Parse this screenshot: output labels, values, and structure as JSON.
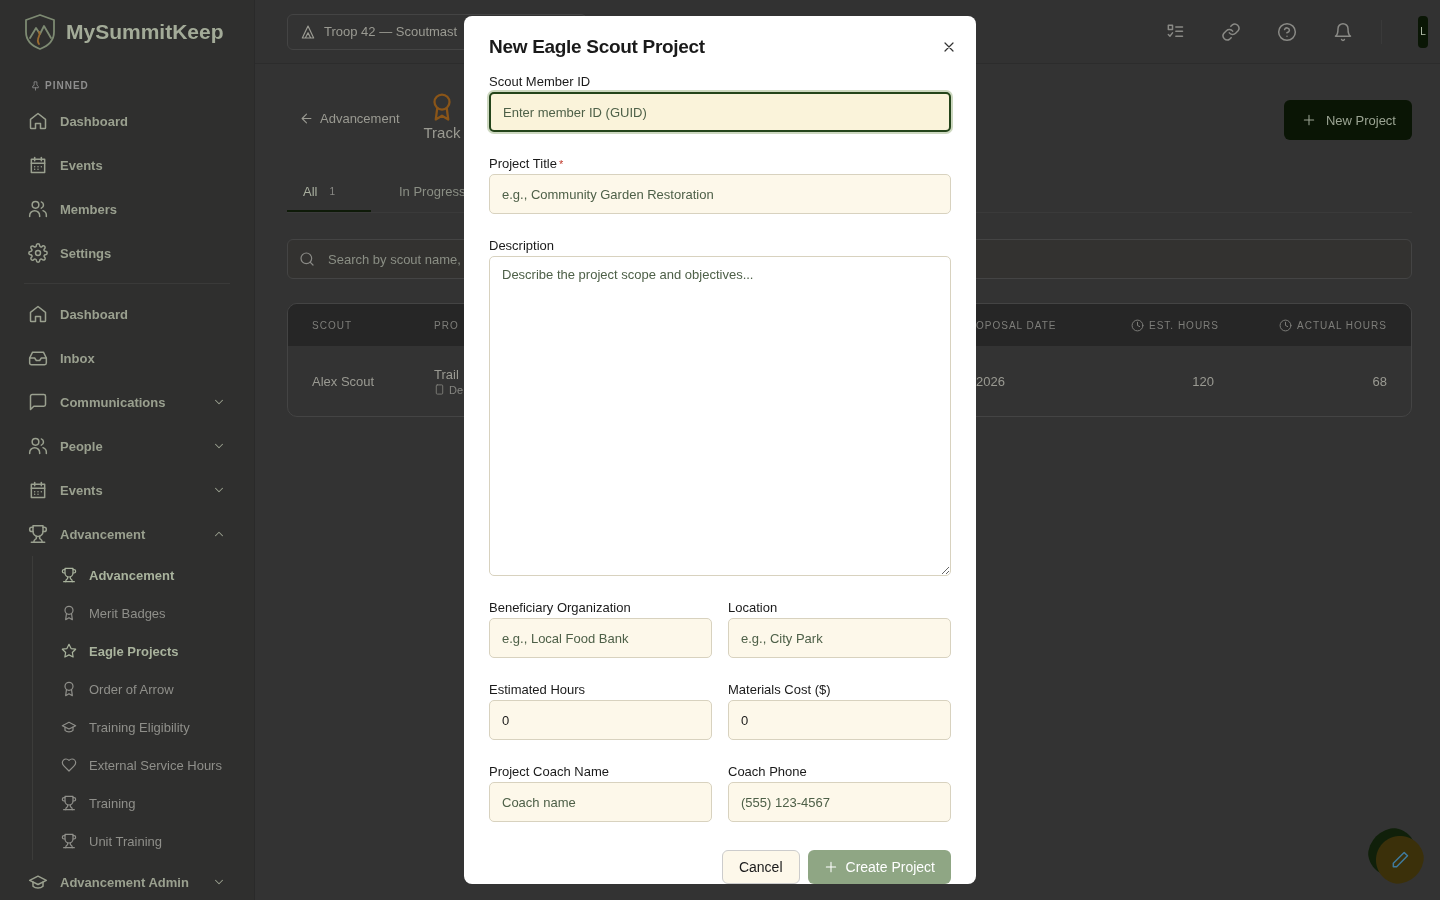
{
  "app": {
    "logo_text": "MySummitKeep"
  },
  "sidebar": {
    "pinned_label": "PINNED",
    "pinned": [
      {
        "label": "Dashboard"
      },
      {
        "label": "Events"
      },
      {
        "label": "Members"
      },
      {
        "label": "Settings"
      }
    ],
    "nav": [
      {
        "label": "Dashboard"
      },
      {
        "label": "Inbox"
      },
      {
        "label": "Communications",
        "expanded": false
      },
      {
        "label": "People",
        "expanded": false
      },
      {
        "label": "Events",
        "expanded": false
      },
      {
        "label": "Advancement",
        "expanded": true,
        "children": [
          {
            "label": "Advancement",
            "selected": true
          },
          {
            "label": "Merit Badges",
            "selected": false
          },
          {
            "label": "Eagle Projects",
            "selected": true
          },
          {
            "label": "Order of Arrow",
            "selected": false
          },
          {
            "label": "Training Eligibility",
            "selected": false
          },
          {
            "label": "External Service Hours",
            "selected": false
          },
          {
            "label": "Training",
            "selected": false
          },
          {
            "label": "Unit Training",
            "selected": false
          }
        ]
      },
      {
        "label": "Advancement Admin",
        "expanded": false
      }
    ]
  },
  "header": {
    "unit_selector": "Troop 42 — Scoutmast",
    "avatar": "L"
  },
  "page": {
    "back_link": "Advancement",
    "title_partial": "Track",
    "new_button": "New Project",
    "tabs": [
      {
        "label": "All",
        "count": "1",
        "selected": true
      },
      {
        "label": "In Progress",
        "selected": false
      }
    ],
    "search_placeholder": "Search by scout name,",
    "table": {
      "columns": [
        "SCOUT",
        "PRO",
        "OPOSAL DATE",
        "EST. HOURS",
        "ACTUAL HOURS"
      ],
      "rows": [
        {
          "scout": "Alex Scout",
          "project": "Trail",
          "project_sub": "De",
          "date": "2026",
          "est_hours": "120",
          "actual_hours": "68"
        }
      ]
    }
  },
  "modal": {
    "title": "New Eagle Scout Project",
    "fields": [
      {
        "kind": "text",
        "label": "Scout Member ID",
        "placeholder": "Enter member ID (GUID)",
        "focused": true
      },
      {
        "kind": "text",
        "label": "Project Title",
        "required_mark": "*",
        "placeholder": "e.g., Community Garden Restoration",
        "focused": false
      },
      {
        "kind": "textarea",
        "label": "Description",
        "placeholder": "Describe the project scope and objectives...",
        "focused": false
      }
    ],
    "field_pairs": [
      [
        {
          "kind": "text",
          "label": "Beneficiary Organization",
          "placeholder": "e.g., Local Food Bank",
          "focused": false
        },
        {
          "kind": "text",
          "label": "Location",
          "placeholder": "e.g., City Park",
          "focused": false
        }
      ],
      [
        {
          "kind": "text",
          "label": "Estimated Hours",
          "value": "0",
          "focused": false
        },
        {
          "kind": "text",
          "label": "Materials Cost ($)",
          "value": "0",
          "focused": false
        }
      ],
      [
        {
          "kind": "text",
          "label": "Project Coach Name",
          "placeholder": "Coach name",
          "focused": false
        },
        {
          "kind": "text",
          "label": "Coach Phone",
          "placeholder": "(555) 123-4567",
          "focused": false
        }
      ]
    ],
    "cancel_button": "Cancel",
    "create_button": "Create Project"
  }
}
